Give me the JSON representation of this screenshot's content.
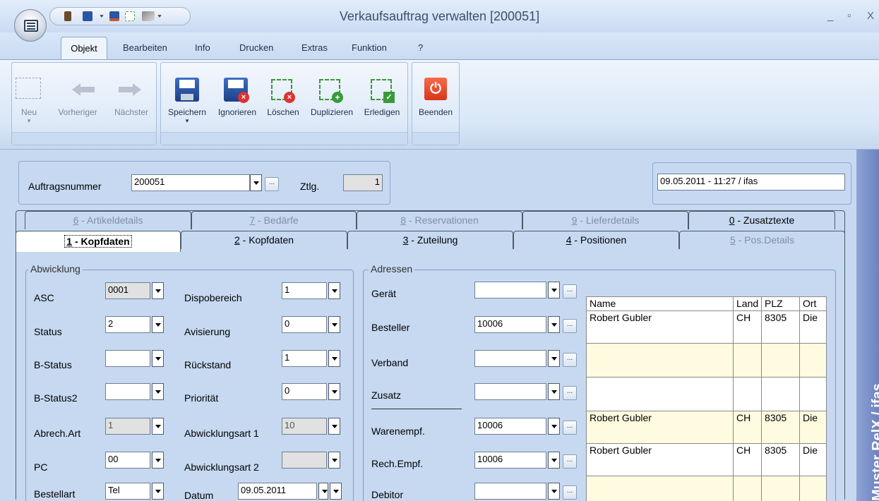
{
  "window": {
    "title": "Verkaufsauftrag verwalten [200051]",
    "minimize": "_",
    "maximize": "▫",
    "close": "X"
  },
  "menu": {
    "tabs": [
      "Objekt",
      "Bearbeiten",
      "Info",
      "Drucken",
      "Extras",
      "Funktion",
      "?"
    ]
  },
  "ribbon": {
    "neu": "Neu",
    "vorheriger": "Vorheriger",
    "naechster": "Nächster",
    "speichern": "Speichern",
    "ignorieren": "Ignorieren",
    "loeschen": "Löschen",
    "duplizieren": "Duplizieren",
    "erledigen": "Erledigen",
    "beenden": "Beenden"
  },
  "header": {
    "auftragsnummer_label": "Auftragsnummer",
    "auftragsnummer_value": "200051",
    "ztlg_label": "Ztlg.",
    "ztlg_value": "1",
    "timestamp": "09.05.2011 - 11:27 / ifas"
  },
  "tabs_top": [
    {
      "num": "6",
      "label": " - Artikeldetails"
    },
    {
      "num": "7",
      "label": " - Bedärfe"
    },
    {
      "num": "8",
      "label": " - Reservationen"
    },
    {
      "num": "9",
      "label": " - Lieferdetails"
    },
    {
      "num": "0",
      "label": " - Zusatztexte"
    }
  ],
  "tabs_bottom": [
    {
      "num": "1",
      "label": " - Kopfdaten"
    },
    {
      "num": "2",
      "label": " - Kopfdaten"
    },
    {
      "num": "3",
      "label": " - Zuteilung"
    },
    {
      "num": "4",
      "label": " - Positionen"
    },
    {
      "num": "5",
      "label": " - Pos.Details"
    }
  ],
  "abwicklung": {
    "legend": "Abwicklung",
    "asc_label": "ASC",
    "asc_value": "0001",
    "status_label": "Status",
    "status_value": "2",
    "bstatus_label": "B-Status",
    "bstatus_value": "",
    "bstatus2_label": "B-Status2",
    "bstatus2_value": "",
    "abrech_label": "Abrech.Art",
    "abrech_value": "1",
    "pc_label": "PC",
    "pc_value": "00",
    "bestellart_label": "Bestellart",
    "bestellart_value": "Tel",
    "dispo_label": "Dispobereich",
    "dispo_value": "1",
    "avis_label": "Avisierung",
    "avis_value": "0",
    "rueck_label": "Rückstand",
    "rueck_value": "1",
    "prio_label": "Priorität",
    "prio_value": "0",
    "abw1_label": "Abwicklungsart 1",
    "abw1_value": "10",
    "abw2_label": "Abwicklungsart 2",
    "abw2_value": "",
    "datum_label": "Datum",
    "datum_value": "09.05.2011"
  },
  "adressen": {
    "legend": "Adressen",
    "geraet_label": "Gerät",
    "geraet_value": "",
    "besteller_label": "Besteller",
    "besteller_value": "10006",
    "verband_label": "Verband",
    "verband_value": "",
    "zusatz_label": "Zusatz",
    "zusatz_value": "",
    "warenempf_label": "Warenempf.",
    "warenempf_value": "10006",
    "rechempf_label": "Rech.Empf.",
    "rechempf_value": "10006",
    "debitor_label": "Debitor",
    "debitor_value": ""
  },
  "address_table": {
    "headers": [
      "Name",
      "Land",
      "PLZ",
      "Ort"
    ],
    "rows": [
      [
        "Robert Gubler",
        "CH",
        "8305",
        "Die"
      ],
      [
        "",
        "",
        "",
        ""
      ],
      [
        "",
        "",
        "",
        ""
      ],
      [
        "Robert Gubler",
        "CH",
        "8305",
        "Die"
      ],
      [
        "Robert Gubler",
        "CH",
        "8305",
        "Die"
      ],
      [
        "",
        "",
        "",
        ""
      ]
    ]
  },
  "sidebar": {
    "text": "Muster RelX / ifas"
  }
}
